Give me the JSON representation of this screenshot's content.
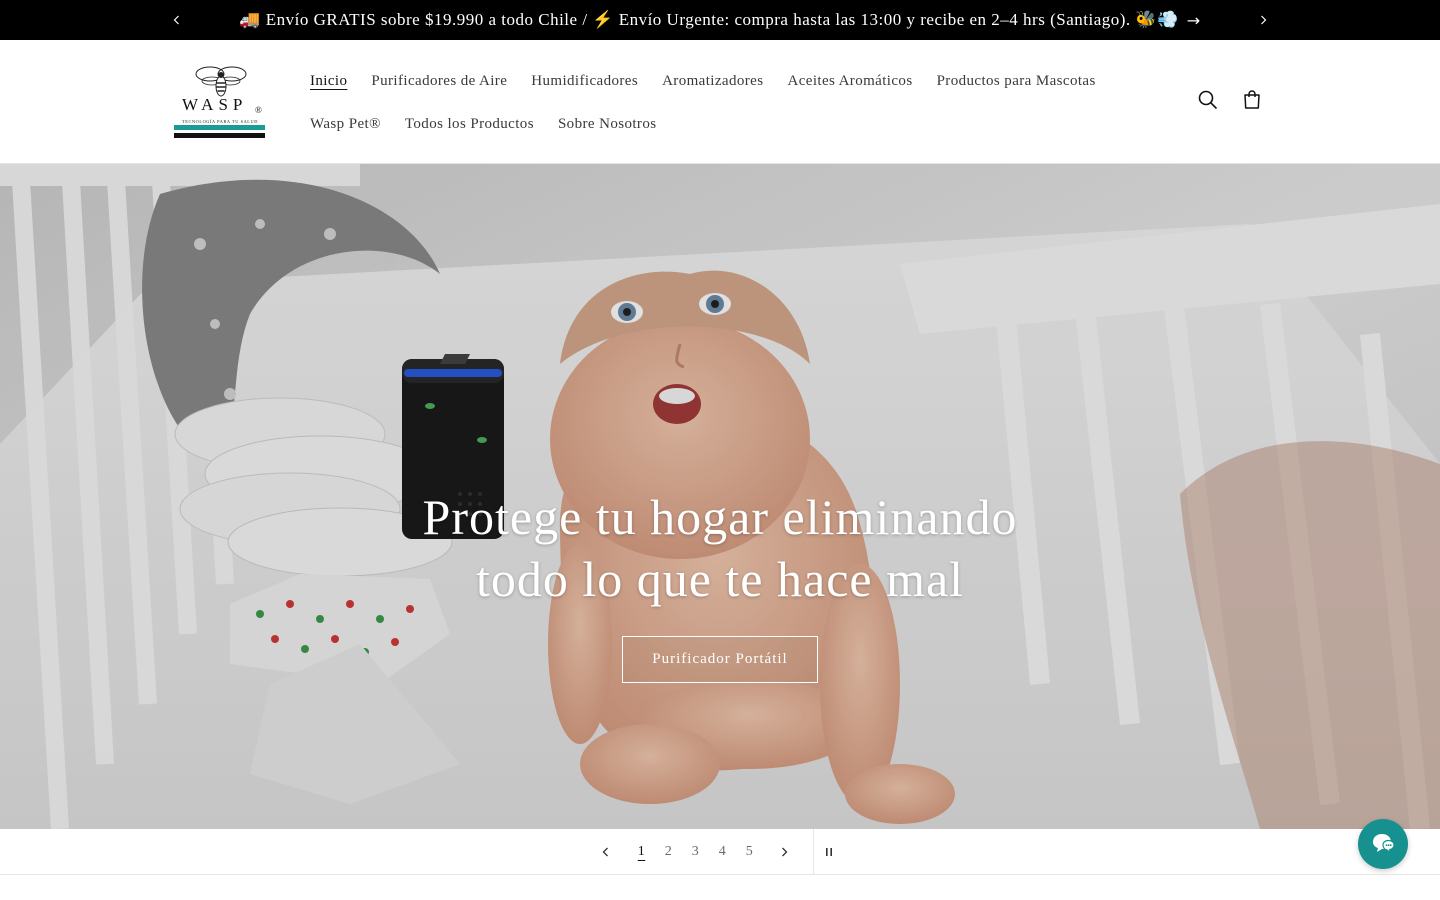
{
  "announcement": {
    "message": "🚚 Envío GRATIS sobre $19.990 a todo Chile / ⚡ Envío Urgente: compra hasta las 13:00 y recibe en 2–4 hrs (Santiago). 🐝💨",
    "arrow": "→",
    "prev_icon": "chevron-left-icon",
    "next_icon": "chevron-right-icon"
  },
  "header": {
    "logo": {
      "brand": "WASP",
      "registered": "®",
      "tagline": "TECNOLOGÍA PARA TU SALUD"
    },
    "nav": [
      {
        "label": "Inicio",
        "active": true
      },
      {
        "label": "Purificadores de Aire",
        "active": false
      },
      {
        "label": "Humidificadores",
        "active": false
      },
      {
        "label": "Aromatizadores",
        "active": false
      },
      {
        "label": "Aceites Aromáticos",
        "active": false
      },
      {
        "label": "Productos para Mascotas",
        "active": false
      },
      {
        "label": "Wasp Pet®",
        "active": false
      },
      {
        "label": "Todos los Productos",
        "active": false
      },
      {
        "label": "Sobre Nosotros",
        "active": false
      }
    ],
    "icons": [
      "search-icon",
      "cart-icon"
    ]
  },
  "hero": {
    "title": "Protege tu hogar eliminando todo lo que te hace mal",
    "button_label": "Purificador Portátil"
  },
  "slider": {
    "slides": [
      "1",
      "2",
      "3",
      "4",
      "5"
    ],
    "current": "1"
  },
  "colors": {
    "announcement_bg": "#000000",
    "chat_bubble": "#17918f",
    "logo_stripe_teal": "#1a9b97",
    "purifier_glow": "#2a64ff"
  }
}
